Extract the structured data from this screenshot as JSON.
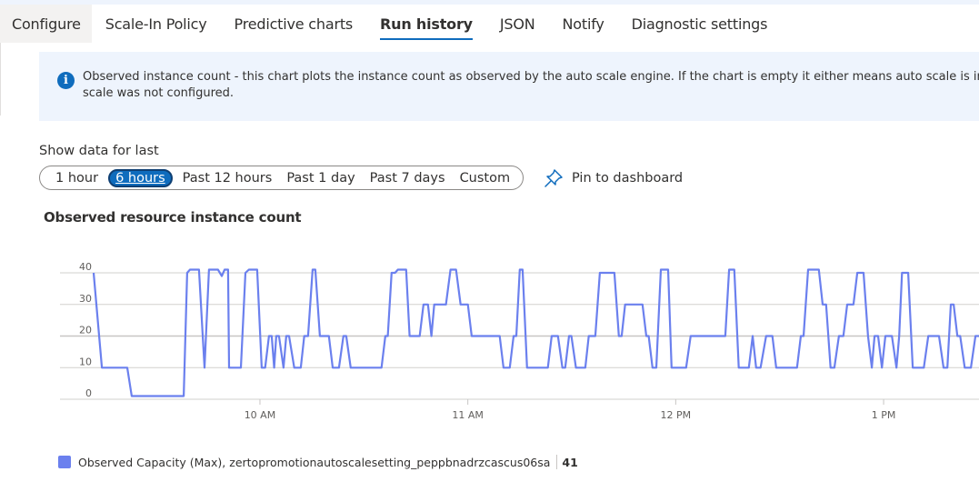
{
  "tabs": [
    {
      "label": "Configure",
      "active": false
    },
    {
      "label": "Scale-In Policy",
      "active": false
    },
    {
      "label": "Predictive charts",
      "active": false
    },
    {
      "label": "Run history",
      "active": true
    },
    {
      "label": "JSON",
      "active": false
    },
    {
      "label": "Notify",
      "active": false
    },
    {
      "label": "Diagnostic settings",
      "active": false
    }
  ],
  "info": {
    "icon": "info-icon",
    "line1": "Observed instance count - this chart plots the instance count as observed by the auto scale engine. If the chart is empty it either means auto scale is in cool",
    "line2": "scale was not configured."
  },
  "time_range": {
    "label": "Show data for last",
    "options": [
      "1 hour",
      "6 hours",
      "Past 12 hours",
      "Past 1 day",
      "Past 7 days",
      "Custom"
    ],
    "selected": "6 hours"
  },
  "pin": {
    "icon": "pin-icon",
    "label": "Pin to dashboard"
  },
  "chart_title": "Observed resource instance count",
  "legend": {
    "label": "Observed Capacity (Max), zertopromotionautoscalesetting_peppbnadrzcascus06sa",
    "value": "41",
    "color": "#6b80ee"
  },
  "chart_data": {
    "type": "line",
    "title": "Observed resource instance count",
    "xlabel": "",
    "ylabel": "",
    "ylim": [
      0,
      40
    ],
    "yticks": [
      0,
      10,
      20,
      30,
      40
    ],
    "xlim_minutes_after_9am": [
      12,
      279
    ],
    "xticks": [
      {
        "label": "10 AM",
        "minutes_after_9am": 60
      },
      {
        "label": "11 AM",
        "minutes_after_9am": 120
      },
      {
        "label": "12 PM",
        "minutes_after_9am": 180
      },
      {
        "label": "1 PM",
        "minutes_after_9am": 240
      }
    ],
    "grid": true,
    "legend_position": "bottom-left",
    "series": [
      {
        "name": "Observed Capacity (Max), zertopromotionautoscalesetting_peppbnadrzcascus06sa",
        "color": "#6b80ee",
        "points_minutes_after_9am": [
          [
            12.0,
            40
          ],
          [
            14.4,
            10
          ],
          [
            21.7,
            10
          ],
          [
            23.0,
            1
          ],
          [
            38.0,
            1
          ],
          [
            39.0,
            40
          ],
          [
            39.8,
            41
          ],
          [
            42.4,
            41
          ],
          [
            44.0,
            10
          ],
          [
            45.3,
            41
          ],
          [
            47.9,
            41
          ],
          [
            49.0,
            39
          ],
          [
            49.8,
            41
          ],
          [
            50.8,
            41
          ],
          [
            51.1,
            10
          ],
          [
            54.5,
            10
          ],
          [
            55.8,
            40
          ],
          [
            56.8,
            41
          ],
          [
            59.2,
            41
          ],
          [
            60.5,
            10
          ],
          [
            61.5,
            10
          ],
          [
            62.6,
            20
          ],
          [
            63.4,
            20
          ],
          [
            64.1,
            10
          ],
          [
            64.7,
            20
          ],
          [
            65.5,
            20
          ],
          [
            66.8,
            10
          ],
          [
            67.6,
            20
          ],
          [
            68.4,
            20
          ],
          [
            69.9,
            10
          ],
          [
            71.8,
            10
          ],
          [
            72.8,
            20
          ],
          [
            73.9,
            20
          ],
          [
            75.2,
            41
          ],
          [
            76.0,
            41
          ],
          [
            77.3,
            20
          ],
          [
            79.9,
            20
          ],
          [
            81.0,
            10
          ],
          [
            82.8,
            10
          ],
          [
            84.1,
            20
          ],
          [
            84.9,
            20
          ],
          [
            86.2,
            10
          ],
          [
            95.1,
            10
          ],
          [
            96.2,
            20
          ],
          [
            96.9,
            20
          ],
          [
            98.0,
            40
          ],
          [
            99.0,
            40
          ],
          [
            99.8,
            41
          ],
          [
            102.2,
            41
          ],
          [
            103.2,
            20
          ],
          [
            106.1,
            20
          ],
          [
            107.2,
            30
          ],
          [
            108.5,
            30
          ],
          [
            109.5,
            20
          ],
          [
            110.3,
            30
          ],
          [
            113.7,
            30
          ],
          [
            115.0,
            41
          ],
          [
            116.6,
            41
          ],
          [
            117.9,
            30
          ],
          [
            120.0,
            30
          ],
          [
            121.1,
            20
          ],
          [
            129.2,
            20
          ],
          [
            130.3,
            10
          ],
          [
            132.1,
            10
          ],
          [
            133.2,
            20
          ],
          [
            134.0,
            20
          ],
          [
            135.0,
            41
          ],
          [
            135.8,
            41
          ],
          [
            137.1,
            10
          ],
          [
            143.1,
            10
          ],
          [
            144.2,
            20
          ],
          [
            146.0,
            20
          ],
          [
            147.3,
            10
          ],
          [
            148.1,
            10
          ],
          [
            149.2,
            20
          ],
          [
            149.9,
            20
          ],
          [
            151.2,
            10
          ],
          [
            153.9,
            10
          ],
          [
            154.9,
            20
          ],
          [
            156.8,
            20
          ],
          [
            158.1,
            40
          ],
          [
            162.3,
            40
          ],
          [
            163.6,
            20
          ],
          [
            164.4,
            20
          ],
          [
            165.4,
            30
          ],
          [
            170.4,
            30
          ],
          [
            171.5,
            20
          ],
          [
            172.2,
            20
          ],
          [
            173.3,
            10
          ],
          [
            174.4,
            10
          ],
          [
            175.7,
            41
          ],
          [
            177.8,
            41
          ],
          [
            178.8,
            10
          ],
          [
            183.0,
            10
          ],
          [
            184.3,
            20
          ],
          [
            194.3,
            20
          ],
          [
            195.4,
            41
          ],
          [
            196.9,
            41
          ],
          [
            198.2,
            10
          ],
          [
            201.1,
            10
          ],
          [
            202.2,
            20
          ],
          [
            203.2,
            10
          ],
          [
            204.5,
            10
          ],
          [
            206.1,
            20
          ],
          [
            207.9,
            20
          ],
          [
            209.0,
            10
          ],
          [
            215.0,
            10
          ],
          [
            216.1,
            20
          ],
          [
            216.9,
            20
          ],
          [
            218.2,
            41
          ],
          [
            221.3,
            41
          ],
          [
            222.4,
            30
          ],
          [
            223.4,
            30
          ],
          [
            224.7,
            10
          ],
          [
            225.8,
            10
          ],
          [
            227.1,
            20
          ],
          [
            228.4,
            20
          ],
          [
            229.5,
            30
          ],
          [
            231.3,
            30
          ],
          [
            232.4,
            40
          ],
          [
            234.2,
            40
          ],
          [
            235.5,
            20
          ],
          [
            236.6,
            10
          ],
          [
            237.4,
            20
          ],
          [
            238.4,
            20
          ],
          [
            239.5,
            10
          ],
          [
            240.5,
            20
          ],
          [
            242.4,
            20
          ],
          [
            243.7,
            10
          ],
          [
            244.5,
            20
          ],
          [
            245.3,
            40
          ],
          [
            247.1,
            40
          ],
          [
            248.4,
            10
          ],
          [
            251.6,
            10
          ],
          [
            252.9,
            20
          ],
          [
            256.0,
            20
          ],
          [
            257.3,
            10
          ],
          [
            258.4,
            10
          ],
          [
            259.4,
            30
          ],
          [
            260.2,
            30
          ],
          [
            261.3,
            20
          ],
          [
            262.1,
            20
          ],
          [
            263.4,
            10
          ],
          [
            265.2,
            10
          ],
          [
            266.5,
            20
          ],
          [
            267.6,
            20
          ]
        ]
      }
    ]
  }
}
